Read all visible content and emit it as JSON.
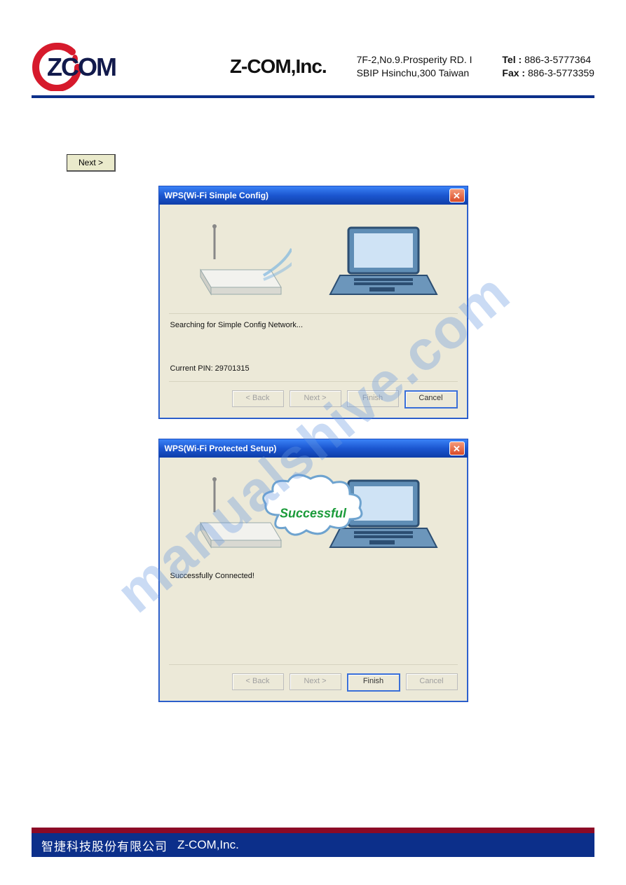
{
  "header": {
    "logo_text": "ZCOM",
    "company": "Z-COM,Inc.",
    "addr_line1": "7F-2,No.9.Prosperity RD. I",
    "addr_line2": "SBIP Hsinchu,300 Taiwan",
    "tel_label": "Tel :",
    "tel_value": "886-3-5777364",
    "fax_label": "Fax :",
    "fax_value": "886-3-5773359"
  },
  "watermark": "manualshive.com",
  "standalone_next": "Next >",
  "dialog1": {
    "title": "WPS(Wi-Fi Simple Config)",
    "status": "Searching for Simple Config Network...",
    "pin": "Current PIN: 29701315",
    "buttons": {
      "back": "< Back",
      "next": "Next >",
      "finish": "Finish",
      "cancel": "Cancel"
    }
  },
  "dialog2": {
    "title": "WPS(Wi-Fi Protected Setup)",
    "cloud": "Successful",
    "status": "Successfully Connected!",
    "buttons": {
      "back": "< Back",
      "next": "Next >",
      "finish": "Finish",
      "cancel": "Cancel"
    }
  },
  "footer": {
    "cn": "智捷科技股份有限公司",
    "en": "Z-COM,Inc."
  }
}
